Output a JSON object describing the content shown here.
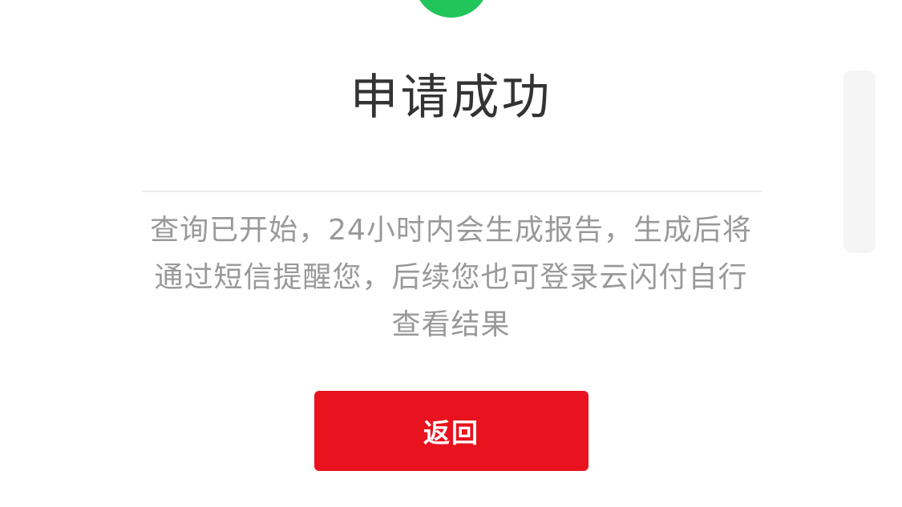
{
  "result": {
    "title": "申请成功",
    "message": "查询已开始，24小时内会生成报告，生成后将通过短信提醒您，后续您也可登录云闪付自行查看结果"
  },
  "actions": {
    "back_label": "返回"
  },
  "colors": {
    "success": "#22c55a",
    "primary_button": "#e8131e",
    "title_text": "#333333",
    "body_text": "#999999"
  },
  "icons": {
    "status": "success-check-icon"
  }
}
